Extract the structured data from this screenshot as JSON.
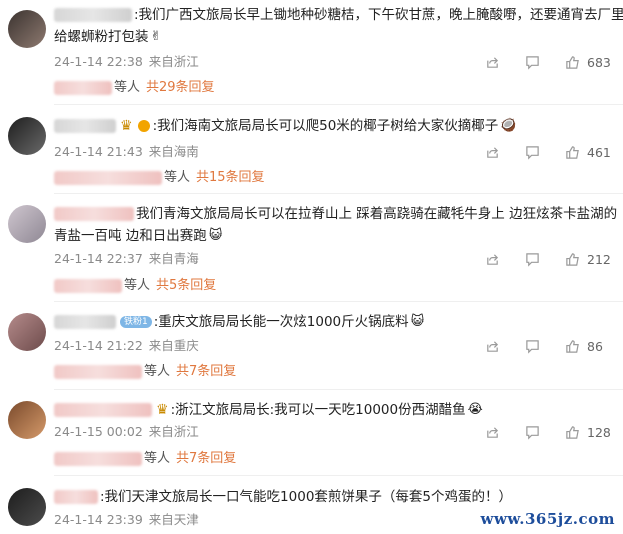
{
  "comments": [
    {
      "text_line1": ":我们广西文旅局长早上锄地种砂糖桔，下午砍甘蔗，晚上腌酸嘢，还要通宵去厂里",
      "text_line2": "给螺蛳粉打包装",
      "emoji": "✌",
      "time": "24-1-14 22:38",
      "location": "来自浙江",
      "likes": "683",
      "reply_suffix": "等人",
      "reply_link": "共29条回复"
    },
    {
      "text_line1": ":我们海南文旅局局长可以爬50米的椰子树给大家伙摘椰子",
      "emoji": "🥥",
      "time": "24-1-14 21:43",
      "location": "来自海南",
      "likes": "461",
      "reply_suffix": "等人",
      "reply_link": "共15条回复"
    },
    {
      "text_line1": "我们青海文旅局局长可以在拉脊山上 踩着高跷骑在藏牦牛身上 边狂炫茶卡盐湖的",
      "text_line2": "青盐一百吨 边和日出赛跑",
      "emoji": "😺",
      "time": "24-1-14 22:37",
      "location": "来自青海",
      "likes": "212",
      "reply_suffix": "等人",
      "reply_link": "共5条回复"
    },
    {
      "badge": "铁粉1",
      "text_line1": ":重庆文旅局局长能一次炫1000斤火锅底料",
      "emoji": "😺",
      "time": "24-1-14 21:22",
      "location": "来自重庆",
      "likes": "86",
      "reply_suffix": "等人",
      "reply_link": "共7条回复"
    },
    {
      "text_line1": ":浙江文旅局局长:我可以一天吃10000份西湖醋鱼",
      "emoji": "😭",
      "time": "24-1-15 00:02",
      "location": "来自浙江",
      "likes": "128",
      "reply_suffix": "等人",
      "reply_link": "共7条回复"
    },
    {
      "text_line1": ":我们天津文旅局长一口气能吃1000套煎饼果子（每套5个鸡蛋的！）",
      "time": "24-1-14 23:39",
      "location": "来自天津"
    }
  ],
  "icons": [
    "share-icon",
    "comment-icon",
    "like-icon"
  ],
  "watermark": "www.365jz.com"
}
